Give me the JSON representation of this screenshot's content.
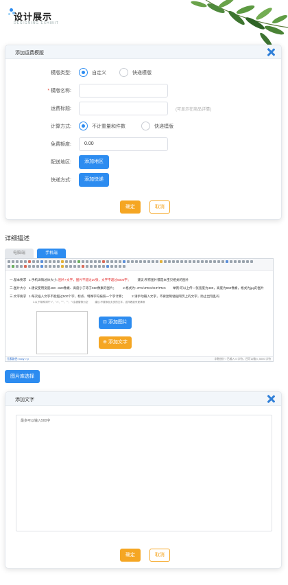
{
  "brand": {
    "title": "设计展示",
    "subtitle": "DESIGNING EXHIBIT"
  },
  "modal1": {
    "title": "添加运费模版",
    "template_type": {
      "label": "模版类型:",
      "options": [
        "自定义",
        "快递模版"
      ],
      "selected": "自定义"
    },
    "template_name": {
      "label": "模版名称:",
      "value": ""
    },
    "freight_title": {
      "label": "运费标题:",
      "value": "",
      "hint": "(可显示在商品详情)"
    },
    "calc_method": {
      "label": "计算方式:",
      "options": [
        "不计重量和件数",
        "快递模版"
      ],
      "selected": "不计重量和件数"
    },
    "free_quota": {
      "label": "免费额度:",
      "value": "0.00"
    },
    "delivery_area": {
      "label": "配送地区:",
      "button": "添加地区"
    },
    "express_method": {
      "label": "快递方式:",
      "button": "添加快递"
    },
    "confirm": "确定",
    "cancel": "取消"
  },
  "detail": {
    "title": "详细描述",
    "tabs": [
      "电脑端",
      "手机端"
    ],
    "active_tab": "手机端",
    "lines": [
      {
        "key": "一.基本要求",
        "text": "1.手机详情总体大小:",
        "red": "图片+文字，图片不超过20张，文字不超过5000字；",
        "extra": "建议:所有图片都是本宝贝相关的图片"
      },
      {
        "key": "二.图片大小",
        "text": "1.建议使用宽度480 ~620像素、高度小于等于960像素的图片；",
        "mid": "2.格式为: JPG/JPEG/GIF/PNG",
        "extra": "举例:可以上传一张宽度为480，高度为960像素，格式为jpg的图片"
      },
      {
        "key": "三.文字要求",
        "text": "1.每次插入文字不能超过500个字，标点、特殊字符按照一个字计算；",
        "extra": "2.请手动输入文字，不要复制粘贴网页上的文字，防止出现乱码"
      },
      {
        "key": "",
        "text": "3.以下特殊字符\"<\"、\">\"、\"\"\"、\"'\"、\"\\\"会被替换为空",
        "extra": "建议:不要添加太多的文字，这样看起来更清晰"
      }
    ],
    "add_image": "添加图片",
    "add_text": "添加文字",
    "status_left": "元素路径: body > p",
    "status_right": "字数统计 / 已输入 0 字符，还可以输入 5000 字符"
  },
  "gallery_button": "图片库选择",
  "modal2": {
    "title": "添加文字",
    "placeholder": "最多可以输入500字",
    "confirm": "确定",
    "cancel": "取消"
  },
  "colors": {
    "primary": "#2d8cf0",
    "orange": "#f5a623",
    "close": "#2f7fd8"
  }
}
